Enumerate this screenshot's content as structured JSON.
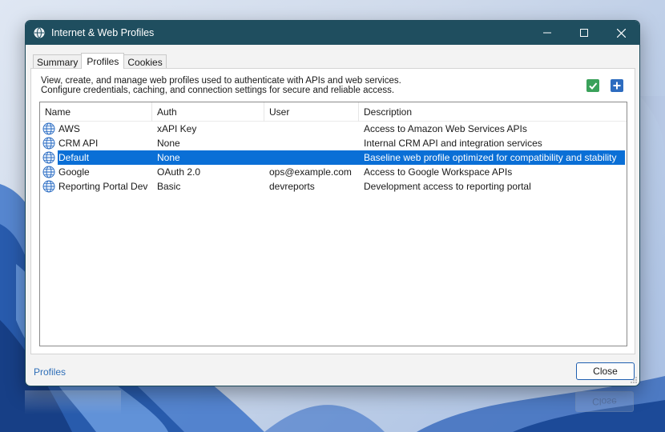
{
  "window": {
    "title": "Internet & Web Profiles"
  },
  "tabs": [
    {
      "label": "Summary"
    },
    {
      "label": "Profiles"
    },
    {
      "label": "Cookies"
    }
  ],
  "panel": {
    "description_line1": "View, create, and manage web profiles used to authenticate with APIs and web services.",
    "description_line2": "Configure credentials, caching, and connection settings for secure and reliable access."
  },
  "columns": {
    "name": "Name",
    "auth": "Auth",
    "user": "User",
    "description": "Description"
  },
  "rows": [
    {
      "name": "AWS",
      "auth": "xAPI Key",
      "user": "",
      "description": "Access to Amazon Web Services APIs"
    },
    {
      "name": "CRM API",
      "auth": "None",
      "user": "",
      "description": "Internal CRM API and integration services"
    },
    {
      "name": "Default",
      "auth": "None",
      "user": "",
      "description": "Baseline web profile optimized for compatibility and stability"
    },
    {
      "name": "Google",
      "auth": "OAuth 2.0",
      "user": "ops@example.com",
      "description": "Access to Google Workspace APIs"
    },
    {
      "name": "Reporting Portal Dev",
      "auth": "Basic",
      "user": "devreports",
      "description": "Development access to reporting portal"
    }
  ],
  "footer": {
    "link": "Profiles",
    "close_label": "Close",
    "ghost_close_label": "Close"
  },
  "colors": {
    "titlebar": "#1f4e5f",
    "selection": "#0a6fd6",
    "accept_icon": "#3aa15a",
    "add_icon": "#2d6cbf"
  }
}
